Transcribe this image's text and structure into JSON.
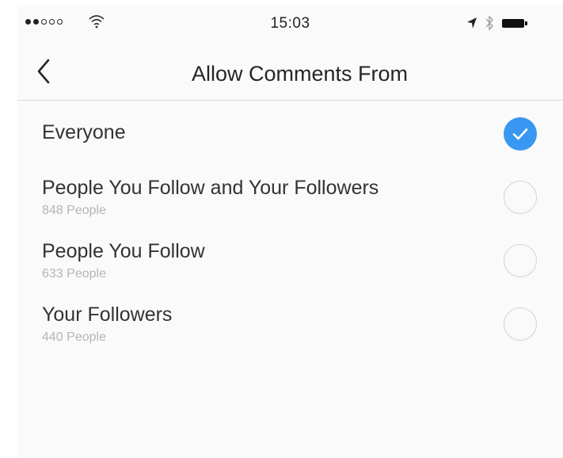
{
  "status_bar": {
    "time": "15:03",
    "signal_icon": "signal-dots-icon",
    "wifi_icon": "wifi-icon",
    "location_icon": "location-arrow-icon",
    "bluetooth_icon": "bluetooth-icon",
    "battery_icon": "battery-icon"
  },
  "nav": {
    "back_icon": "chevron-left-icon",
    "title": "Allow Comments From"
  },
  "options": [
    {
      "label": "Everyone",
      "sub": "",
      "selected": true
    },
    {
      "label": "People You Follow and Your Followers",
      "sub": "848 People",
      "selected": false
    },
    {
      "label": "People You Follow",
      "sub": "633 People",
      "selected": false
    },
    {
      "label": "Your Followers",
      "sub": "440 People",
      "selected": false
    }
  ],
  "colors": {
    "accent": "#3897f0",
    "text": "#333333",
    "subtext": "#b5b5b5",
    "divider": "#dbdbdb",
    "background": "#fafafa"
  }
}
